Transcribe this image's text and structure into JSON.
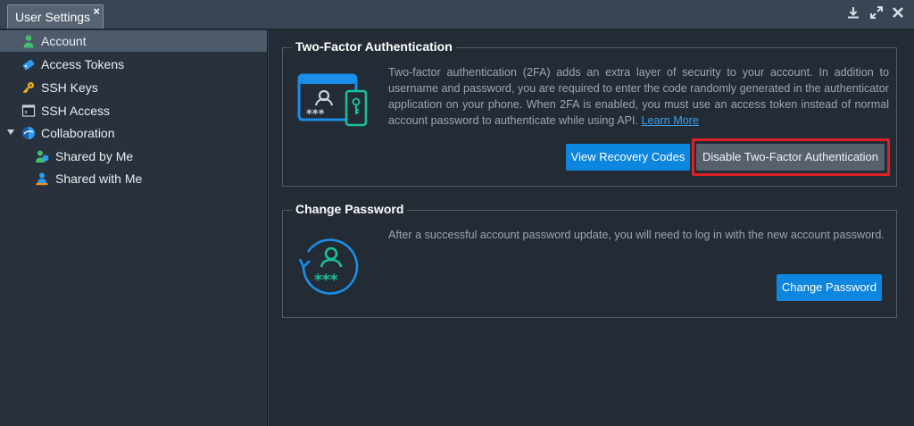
{
  "window": {
    "tab_title": "User Settings",
    "close_glyph": "×"
  },
  "sidebar": {
    "items": [
      {
        "label": "Account",
        "icon": "user-icon",
        "selected": true
      },
      {
        "label": "Access Tokens",
        "icon": "token-icon"
      },
      {
        "label": "SSH Keys",
        "icon": "key-icon"
      },
      {
        "label": "SSH Access",
        "icon": "terminal-icon"
      },
      {
        "label": "Collaboration",
        "icon": "collaboration-icon",
        "expanded": true
      },
      {
        "label": "Shared by Me",
        "icon": "shared-by-me-icon"
      },
      {
        "label": "Shared with Me",
        "icon": "shared-with-me-icon"
      }
    ]
  },
  "two_factor": {
    "title": "Two-Factor Authentication",
    "description": "Two-factor authentication (2FA) adds an extra layer of security to your account. In addition to username and password, you are required to enter the code randomly generated in the authenticator application on your phone. When 2FA is enabled, you must use an access token instead of normal account password to authenticate while using API.",
    "learn_more": "Learn More",
    "view_codes_button": "View Recovery Codes",
    "disable_button": "Disable Two-Factor Authentication"
  },
  "change_password": {
    "title": "Change Password",
    "description": "After a successful account password update, you will need to log in with the new account password.",
    "button": "Change Password"
  },
  "colors": {
    "accent": "#0d86e0",
    "highlight": "#e01f26",
    "icon_blue": "#1a8ee8",
    "icon_green": "#19c29a"
  }
}
